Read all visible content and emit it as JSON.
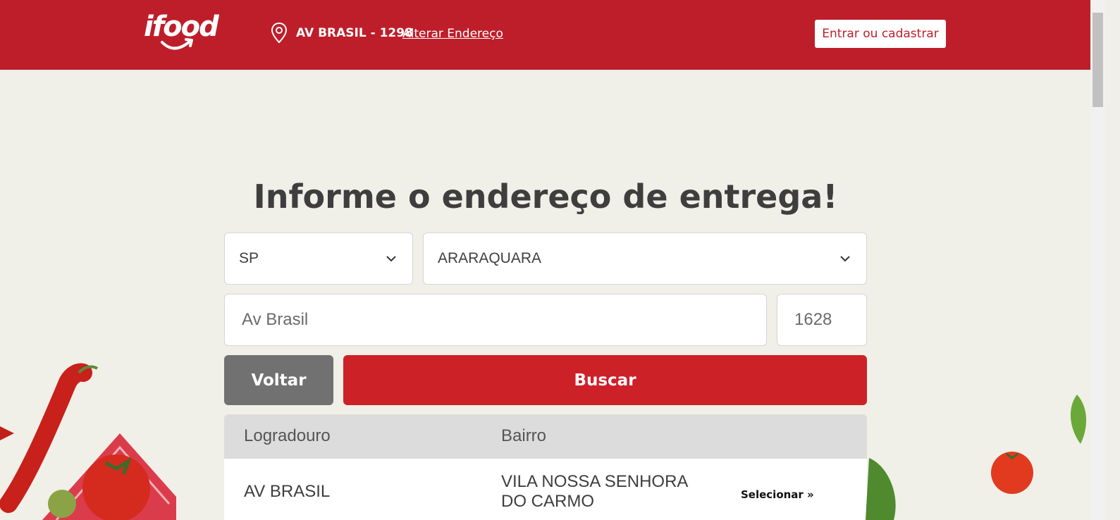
{
  "header": {
    "logo_text": "ifood",
    "current_address": "AV BRASIL - 1298",
    "change_address_label": "Alterar Endereço",
    "login_label": "Entrar ou cadastrar",
    "brand_color": "#be1e2a"
  },
  "main": {
    "title": "Informe o endereço de entrega!",
    "state_select": {
      "value": "SP"
    },
    "city_select": {
      "value": "ARARAQUARA"
    },
    "street_input": {
      "value": "Av Brasil"
    },
    "number_input": {
      "value": "1628"
    },
    "back_label": "Voltar",
    "search_label": "Buscar"
  },
  "results": {
    "headers": [
      "Logradouro",
      "Bairro"
    ],
    "rows": [
      {
        "logradouro": "AV BRASIL",
        "bairro": "VILA NOSSA SENHORA DO CARMO",
        "action": "Selecionar »"
      }
    ]
  },
  "icons": [
    "location-pin-icon",
    "chevron-down-icon"
  ]
}
